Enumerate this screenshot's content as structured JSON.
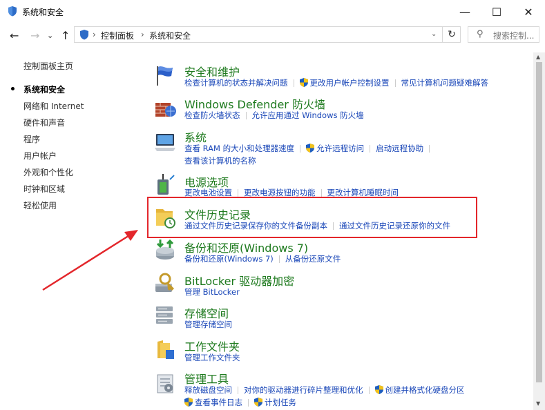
{
  "window": {
    "title": "系统和安全",
    "minimize_symbol": "—",
    "maximize_symbol": "☐",
    "close_symbol": "✕"
  },
  "nav": {
    "back_symbol": "←",
    "forward_symbol": "→",
    "up_symbol": "↑",
    "breadcrumb": [
      "控制面板",
      "系统和安全"
    ],
    "breadcrumb_sep": "›",
    "refresh_symbol": "↻",
    "search_placeholder": "搜索控制..."
  },
  "sidebar": {
    "items": [
      {
        "label": "控制面板主页",
        "current": false
      },
      {
        "label": "系统和安全",
        "current": true
      },
      {
        "label": "网络和 Internet",
        "current": false
      },
      {
        "label": "硬件和声音",
        "current": false
      },
      {
        "label": "程序",
        "current": false
      },
      {
        "label": "用户帐户",
        "current": false
      },
      {
        "label": "外观和个性化",
        "current": false
      },
      {
        "label": "时钟和区域",
        "current": false
      },
      {
        "label": "轻松使用",
        "current": false
      }
    ]
  },
  "categories": [
    {
      "title": "安全和维护",
      "icon": "flag-icon",
      "rows": [
        [
          {
            "text": "检查计算机的状态并解决问题",
            "shield": false
          },
          {
            "text": "更改用户帐户控制设置",
            "shield": true
          },
          {
            "text": "常见计算机问题疑难解答",
            "shield": false
          }
        ]
      ]
    },
    {
      "title": "Windows Defender 防火墙",
      "icon": "firewall-icon",
      "rows": [
        [
          {
            "text": "检查防火墙状态",
            "shield": false
          },
          {
            "text": "允许应用通过 Windows 防火墙",
            "shield": false
          }
        ]
      ]
    },
    {
      "title": "系统",
      "icon": "system-icon",
      "rows": [
        [
          {
            "text": "查看 RAM 的大小和处理器速度",
            "shield": false
          },
          {
            "text": "允许远程访问",
            "shield": true
          },
          {
            "text": "启动远程协助",
            "shield": false
          }
        ],
        [
          {
            "text": "查看该计算机的名称",
            "shield": false
          }
        ]
      ]
    },
    {
      "title": "电源选项",
      "icon": "power-icon",
      "rows": [
        [
          {
            "text": "更改电池设置",
            "shield": false
          },
          {
            "text": "更改电源按钮的功能",
            "shield": false
          },
          {
            "text": "更改计算机睡眠时间",
            "shield": false
          }
        ]
      ]
    },
    {
      "title": "文件历史记录",
      "icon": "file-history-icon",
      "rows": [
        [
          {
            "text": "通过文件历史记录保存你的文件备份副本",
            "shield": false
          },
          {
            "text": "通过文件历史记录还原你的文件",
            "shield": false
          }
        ]
      ]
    },
    {
      "title": "备份和还原(Windows 7)",
      "icon": "backup-icon",
      "rows": [
        [
          {
            "text": "备份和还原(Windows 7)",
            "shield": false
          },
          {
            "text": "从备份还原文件",
            "shield": false
          }
        ]
      ]
    },
    {
      "title": "BitLocker 驱动器加密",
      "icon": "bitlocker-icon",
      "rows": [
        [
          {
            "text": "管理 BitLocker",
            "shield": false
          }
        ]
      ]
    },
    {
      "title": "存储空间",
      "icon": "storage-icon",
      "rows": [
        [
          {
            "text": "管理存储空间",
            "shield": false
          }
        ]
      ]
    },
    {
      "title": "工作文件夹",
      "icon": "work-folders-icon",
      "rows": [
        [
          {
            "text": "管理工作文件夹",
            "shield": false
          }
        ]
      ]
    },
    {
      "title": "管理工具",
      "icon": "admin-tools-icon",
      "rows": [
        [
          {
            "text": "释放磁盘空间",
            "shield": false
          },
          {
            "text": "对你的驱动器进行碎片整理和优化",
            "shield": false
          },
          {
            "text": "创建并格式化硬盘分区",
            "shield": true
          }
        ],
        [
          {
            "text": "查看事件日志",
            "shield": true
          },
          {
            "text": "计划任务",
            "shield": true
          }
        ]
      ]
    }
  ],
  "colors": {
    "title_green": "#1e7a1e",
    "link_blue": "#1a47b8",
    "highlight_red": "#e3262b"
  }
}
